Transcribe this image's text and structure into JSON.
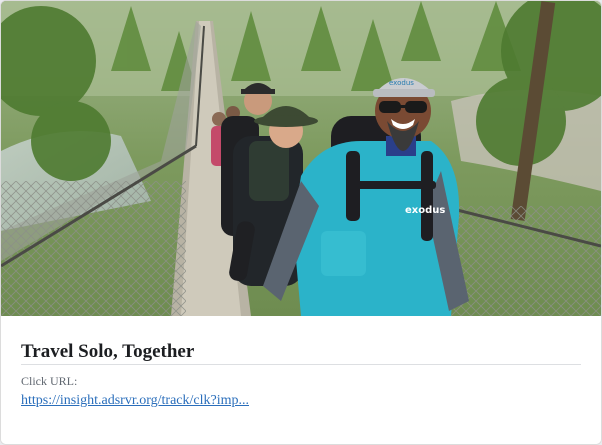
{
  "card": {
    "image_alt": "Hikers crossing a suspension bridge in a forest",
    "shirt_logo_text": "exodus",
    "cap_logo_text": "exodus",
    "title": "Travel Solo, Together",
    "click_url_label": "Click URL:",
    "click_url_text": "https://insight.adsrvr.org/track/clk?imp..."
  },
  "colors": {
    "title": "#1c1e21",
    "label": "#606770",
    "link": "#2a6ebb",
    "divider": "#dddfe2",
    "shirt": "#2bb3c9"
  }
}
